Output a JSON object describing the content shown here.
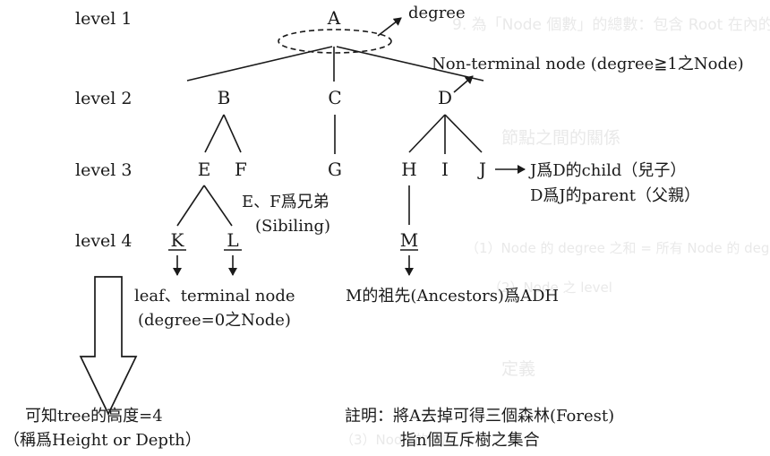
{
  "levels": [
    "level 1",
    "level 2",
    "level 3",
    "level 4"
  ],
  "nodes": {
    "A": "A",
    "B": "B",
    "C": "C",
    "D": "D",
    "E": "E",
    "F": "F",
    "G": "G",
    "H": "H",
    "I": "I",
    "J": "J",
    "K": "K",
    "L": "L",
    "M": "M"
  },
  "annotations": {
    "degree": "degree",
    "non_terminal": "Non-terminal node (degree≧1之Node)",
    "j_child": "J爲D的child（兒子）",
    "d_parent": "D爲J的parent（父親）",
    "siblings": "E、F爲兄弟",
    "siblings_en": "(Sibiling)",
    "leaf": "leaf、terminal node",
    "leaf_degree": "(degree=0之Node)",
    "ancestors": "M的祖先(Ancestors)爲ADH",
    "height": "可知tree的高度=4",
    "height_note": "（稱爲Height or  Depth）",
    "remark": "註明：將A去掉可得三個森林(Forest)",
    "remark_2": "指n個互斥樹之集合"
  },
  "background_text": {
    "line_1": "9.  為「Node 個數」的總數：包含 Root 在內的個數",
    "line_2": "節點之間的關係",
    "line_3": "（1）Node 的 degree 之和 = 所有 Node 的 degree 總和",
    "line_4": "（2）Node 之 level",
    "line_5": "定義",
    "line_6": "（3）Node 的高度"
  }
}
